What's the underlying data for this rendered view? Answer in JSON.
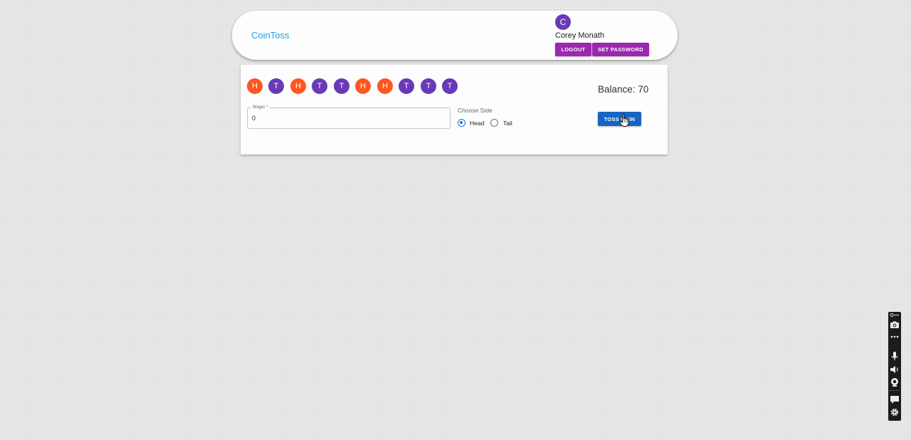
{
  "header": {
    "brand": "CoinToss",
    "user": {
      "avatar_initial": "C",
      "name": "Corey Monath"
    },
    "logout_label": "LOGOUT",
    "set_password_label": "SET PASSWORD"
  },
  "game": {
    "history": [
      "H",
      "T",
      "H",
      "T",
      "T",
      "H",
      "H",
      "T",
      "T",
      "T"
    ],
    "balance_text": "Balance: 70",
    "wager": {
      "label": "Wager *",
      "value": "0"
    },
    "choose_side": {
      "label": "Choose Side",
      "options": [
        "Head",
        "Tail"
      ],
      "selected": "Head"
    },
    "toss_label": "TOSS COIN"
  },
  "colors": {
    "head": "#ff5722",
    "tail": "#673ab7",
    "brand": "#1ba3e3",
    "header_buttons": "#9c27b0",
    "primary": "#1565c0"
  },
  "recorder_toolbar": {
    "icons": [
      "camera-icon",
      "more-icon",
      "microphone-icon",
      "speaker-icon",
      "webcam-icon",
      "chat-icon",
      "gear-icon"
    ]
  }
}
